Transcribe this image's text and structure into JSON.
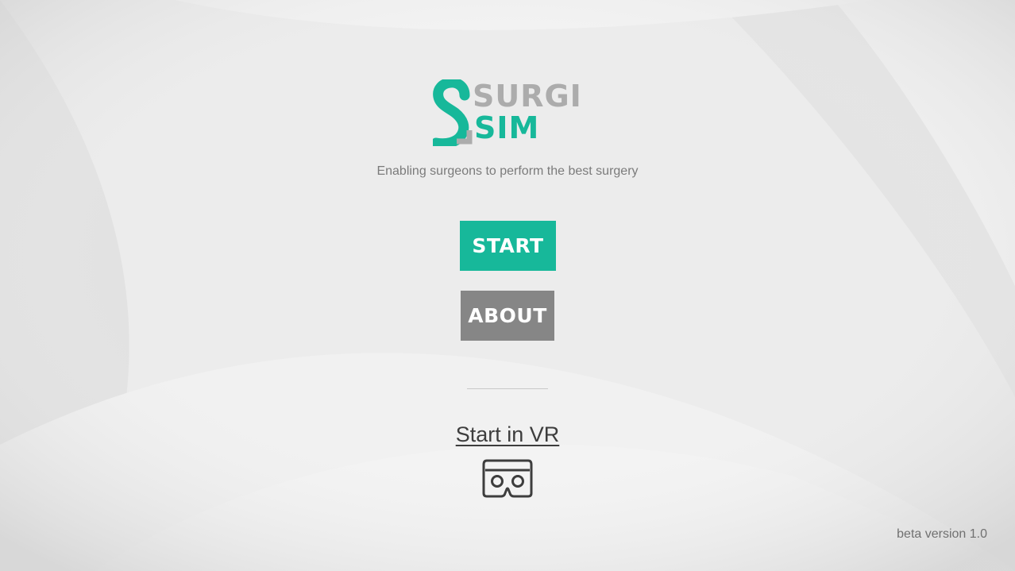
{
  "brand": {
    "word_top": "SURGI",
    "word_bottom": "SIM",
    "accent_color": "#17b89a",
    "gray_color": "#acacac",
    "icon": "surgisim-logo-icon"
  },
  "tagline": "Enabling surgeons to perform the best surgery",
  "menu": {
    "start_label": "START",
    "about_label": "ABOUT"
  },
  "vr": {
    "link_label": "Start in VR",
    "icon": "vr-headset-icon"
  },
  "footer": {
    "version": "beta version 1.0"
  }
}
